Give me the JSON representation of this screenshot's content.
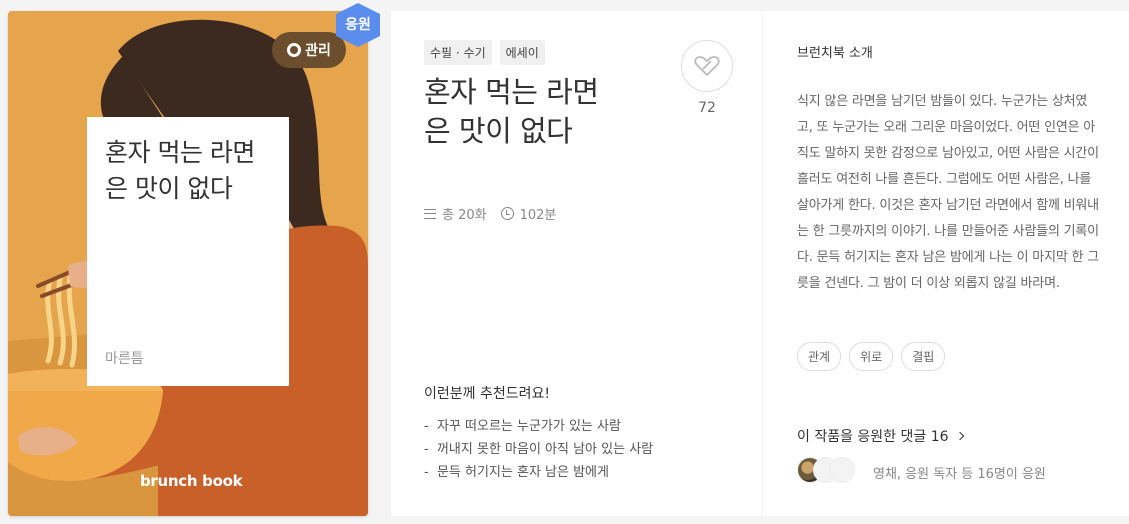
{
  "cover": {
    "title": "혼자 먹는 라면은 맛이 없다",
    "author": "마른틈",
    "brand": "brunch book",
    "manage_label": "관리",
    "badge_label": "응원",
    "colors": {
      "background": "#e6a54c",
      "hair": "#3c2a20",
      "sweater": "#c9602a"
    }
  },
  "book": {
    "tags": [
      "수필 · 수기",
      "에세이"
    ],
    "title": "혼자 먹는 라면은 맛이 없다",
    "likes": "72",
    "episodes": "총 20화",
    "duration": "102분",
    "recommend_title": "이런분께 추천드려요!",
    "recommend": [
      "자꾸 떠오르는 누군가가 있는 사람",
      "꺼내지 못한 마음이 아직 남아 있는 사람",
      "문득 허기지는 혼자 남은 밤에게"
    ]
  },
  "intro": {
    "label": "브런치북 소개",
    "text": "식지 않은 라면을 남기던 밤들이 있다. 누군가는 상처였고, 또 누군가는 오래 그리운 마음이었다. 어떤 인연은 아직도 말하지 못한 감정으로 남아있고, 어떤 사람은 시간이 흘러도 여전히 나를 흔든다. 그럼에도 어떤 사람은, 나를 살아가게 한다. 이것은 혼자 남기던 라면에서 함께 비워내는 한 그릇까지의 이야기. 나를 만들어준 사람들의 기록이다. 문득 허기지는 혼자 남은 밤에게 나는 이 마지막 한 그릇을 건넨다. 그 밤이 더 이상 외롭지 않길 바라며.",
    "keywords": [
      "관계",
      "위로",
      "결핍"
    ],
    "cheer_link": "이 작품을 응원한 댓글 16",
    "cheer_text": "영채, 응원 독자 등 16명이 응원"
  }
}
